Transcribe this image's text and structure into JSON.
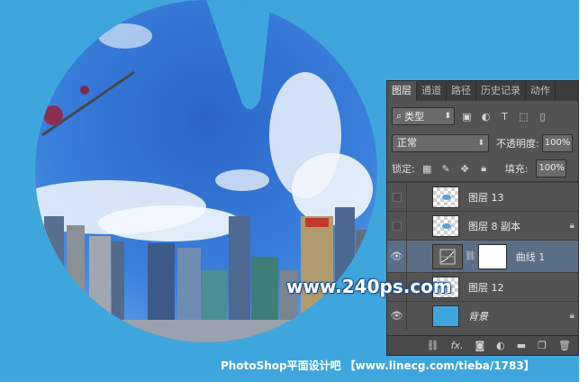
{
  "panel": {
    "tabs": [
      "图层",
      "通道",
      "路径",
      "历史记录",
      "动作"
    ],
    "active_tab": "图层",
    "kind_filter": "类型",
    "filter_icons": [
      "image-filter-icon",
      "adjustment-filter-icon",
      "text-filter-icon",
      "shape-filter-icon",
      "smart-object-filter-icon"
    ],
    "blend_mode": "正常",
    "opacity_label": "不透明度:",
    "opacity_value": "100%",
    "lock_label": "锁定:",
    "fill_label": "填充:",
    "fill_value": "100%",
    "layers": [
      {
        "name": "图层 13",
        "visible": false
      },
      {
        "name": "图层 8 副本",
        "visible": false,
        "locked": true
      },
      {
        "name": "曲线 1",
        "visible": true,
        "selected": true,
        "type": "curves-adjustment"
      },
      {
        "name": "图层 12",
        "visible": false
      },
      {
        "name": "背景",
        "visible": true,
        "locked": true,
        "italic": true
      }
    ],
    "bottom_icons": [
      "link-icon",
      "fx-icon",
      "mask-icon",
      "adjustment-icon",
      "folder-icon",
      "new-layer-icon",
      "trash-icon"
    ],
    "fx_label": "fx."
  },
  "watermark": {
    "site": "www.240ps.com",
    "footer": "PhotoShop平面设计吧 【www.linecg.com/tieba/1783】"
  },
  "colors": {
    "canvas_bg": "#3fa6dd",
    "panel_bg": "#535353",
    "selected_layer": "#5a6e86"
  }
}
